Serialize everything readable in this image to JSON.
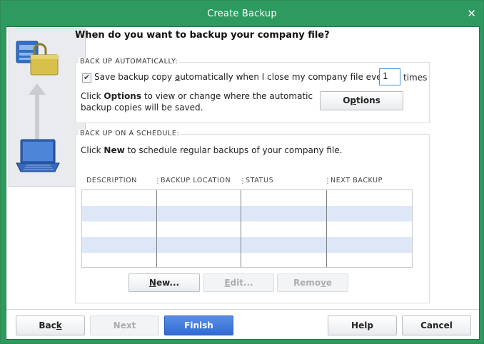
{
  "window": {
    "title": "Create Backup",
    "close_glyph": "✕"
  },
  "heading": "When do you want to backup your company file?",
  "auto": {
    "group_label": "BACK UP AUTOMATICALLY:",
    "checkbox_checked": true,
    "save_label_pre": "Save backup copy ",
    "save_label_key": "a",
    "save_label_post": "utomatically when I close my company file every",
    "times_value": "1",
    "times_label": "times",
    "info_pre": "Click ",
    "info_bold": "Options",
    "info_line1_post": " to view or change where the automatic",
    "info_line2": "backup copies will be saved.",
    "options_button_pre": "O",
    "options_button_key": "p",
    "options_button_post": "tions"
  },
  "schedule": {
    "group_label": "BACK UP ON A SCHEDULE:",
    "info_pre": "Click ",
    "info_bold": "New",
    "info_post": " to schedule regular backups of your company file.",
    "columns": [
      "DESCRIPTION",
      "BACKUP LOCATION",
      "STATUS",
      "NEXT BACKUP"
    ],
    "new_button_key": "N",
    "new_button_rest": "ew...",
    "edit_button_key": "E",
    "edit_button_rest": "dit...",
    "remove_button_pre": "Remo",
    "remove_button_key": "v",
    "remove_button_post": "e"
  },
  "footer": {
    "back_pre": "Bac",
    "back_key": "k",
    "next_label": "Next",
    "finish_label": "Finish",
    "help_label": "Help",
    "cancel_label": "Cancel"
  },
  "icons": {
    "server": "server-icon",
    "lock": "lock-icon",
    "arrow": "arrow-up-icon",
    "laptop": "laptop-icon"
  },
  "colors": {
    "titlebar": "#2f9a5f",
    "primary_button": "#2f6ad3",
    "grid_alt_row": "#dde7f8"
  }
}
